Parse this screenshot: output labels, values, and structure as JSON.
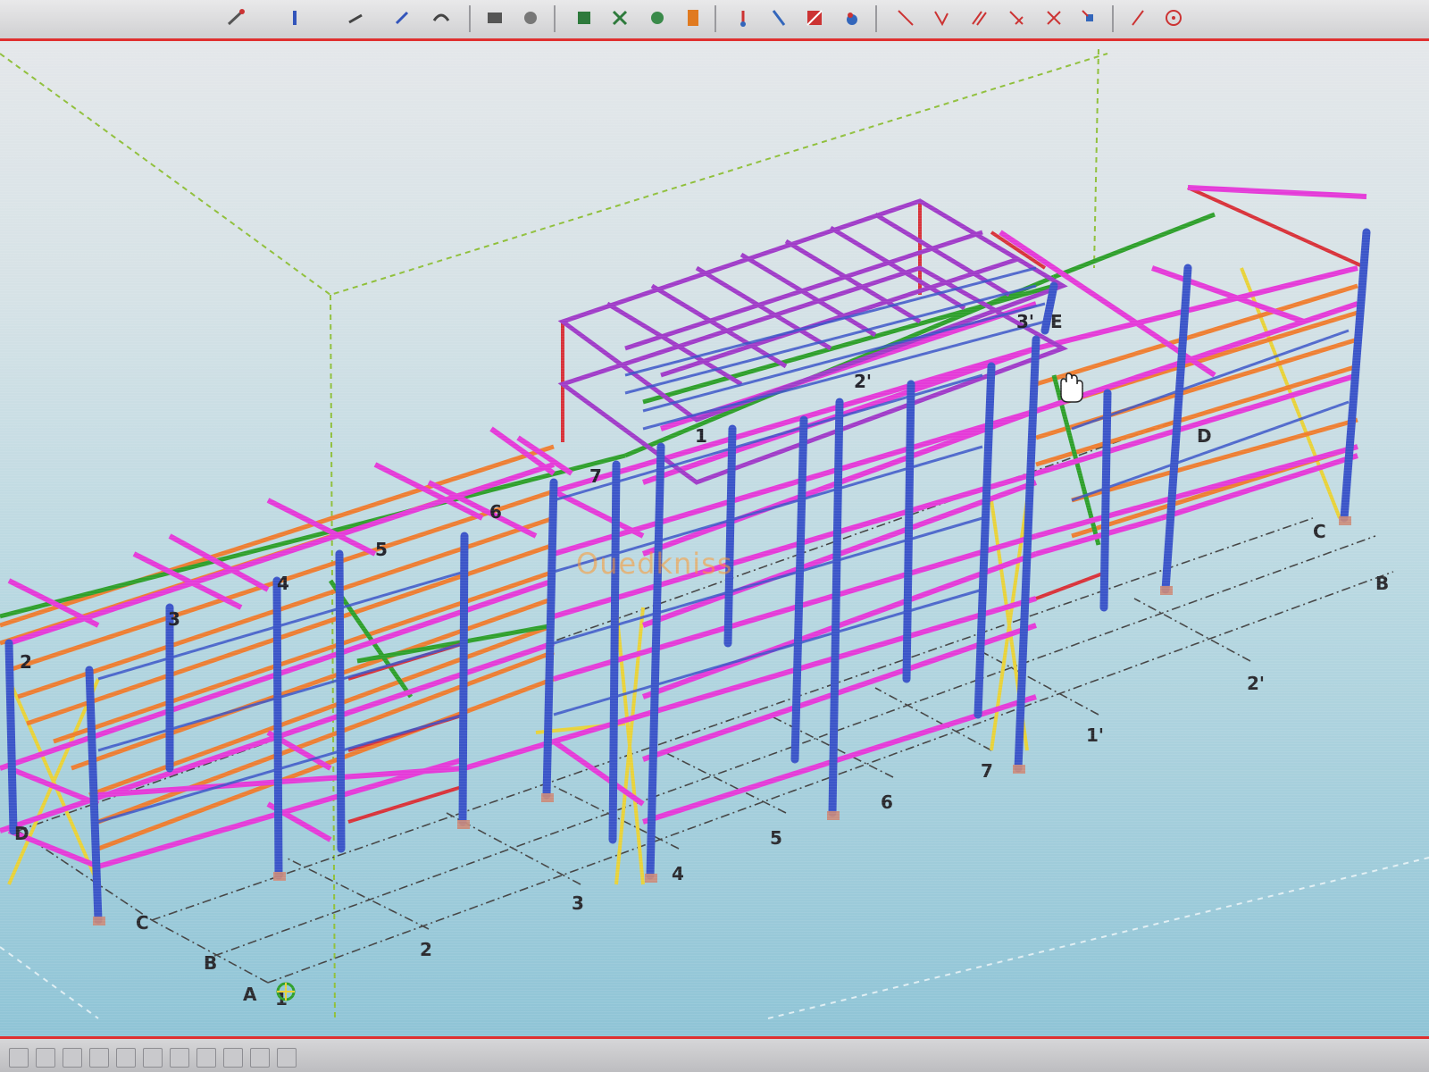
{
  "colors": {
    "column": "#3b55c8",
    "beam_magenta": "#e43bd8",
    "joist_orange": "#f07a2a",
    "beam_green": "#2fa02c",
    "brace_yellow": "#e8d23a",
    "beam_red": "#d8333a",
    "frame_purple": "#a03cc8",
    "frame_red": "#c0303a",
    "grid_dash": "#444444",
    "box_dash": "#8fbf3a",
    "accent_border": "#e03030"
  },
  "toolbar": {
    "tools": [
      {
        "name": "weld-tool-icon"
      },
      {
        "name": "rotate-tool-icon"
      },
      {
        "name": "component-icon"
      },
      {
        "name": "column-icon"
      },
      {
        "name": "beam-icon"
      },
      {
        "name": "plate-icon"
      },
      {
        "name": "bolt-icon"
      },
      {
        "name": "line-icon"
      },
      {
        "name": "angle-icon"
      },
      {
        "name": "parallel-icon"
      },
      {
        "name": "cross-icon"
      },
      {
        "name": "x-icon"
      },
      {
        "name": "point-icon"
      },
      {
        "name": "measure-icon"
      },
      {
        "name": "circle-icon"
      }
    ]
  },
  "model": {
    "watermark": "Ouedkniss",
    "grid_lines_front": [
      "A",
      "B",
      "C",
      "D"
    ],
    "grid_numbers_front": [
      "1",
      "2",
      "3",
      "4",
      "5",
      "6",
      "7",
      "1'",
      "2'"
    ],
    "grid_letters_right": [
      "B",
      "C",
      "D",
      "E"
    ],
    "tower_labels": [
      "1",
      "2'",
      "3'"
    ],
    "top_numbers": [
      "2",
      "3",
      "4",
      "5",
      "6",
      "7"
    ]
  }
}
